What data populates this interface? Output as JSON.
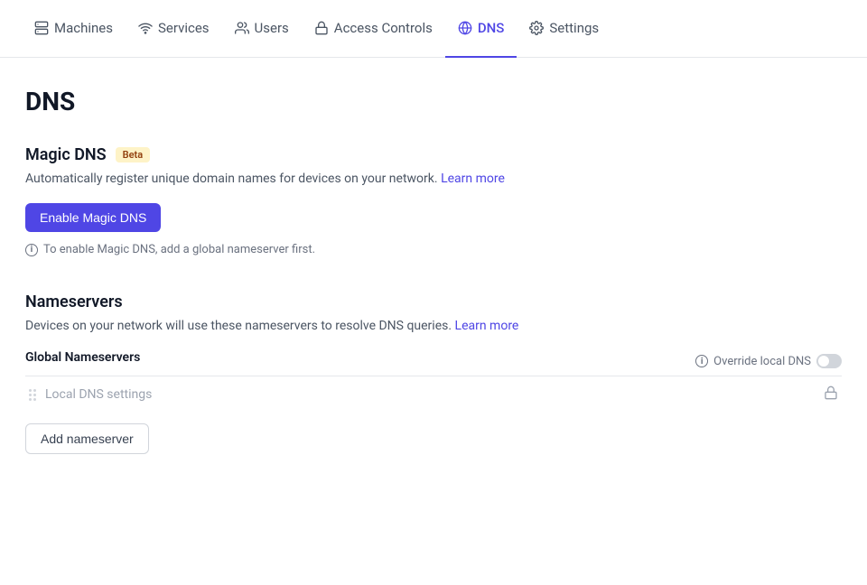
{
  "nav": {
    "items": [
      {
        "id": "machines",
        "label": "Machines",
        "icon": "server",
        "active": false
      },
      {
        "id": "services",
        "label": "Services",
        "icon": "wifi",
        "active": false
      },
      {
        "id": "users",
        "label": "Users",
        "icon": "users",
        "active": false
      },
      {
        "id": "access-controls",
        "label": "Access Controls",
        "icon": "lock",
        "active": false
      },
      {
        "id": "dns",
        "label": "DNS",
        "icon": "globe",
        "active": true
      },
      {
        "id": "settings",
        "label": "Settings",
        "icon": "settings",
        "active": false
      }
    ]
  },
  "page": {
    "title": "DNS"
  },
  "magic_dns": {
    "section_title": "Magic DNS",
    "badge": "Beta",
    "description": "Automatically register unique domain names for devices on your network.",
    "learn_more_label": "Learn more",
    "enable_button": "Enable Magic DNS",
    "info_note": "To enable Magic DNS, add a global nameserver first."
  },
  "nameservers": {
    "section_title": "Nameservers",
    "description": "Devices on your network will use these nameservers to resolve DNS queries.",
    "learn_more_label": "Learn more",
    "global_label": "Global Nameservers",
    "override_label": "Override local DNS",
    "placeholder": "Local DNS settings",
    "add_button": "Add nameserver"
  }
}
